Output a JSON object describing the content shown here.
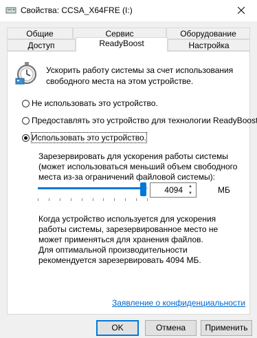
{
  "window": {
    "title": "Свойства: CCSA_X64FRE (I:)"
  },
  "tabs_row1": [
    "Общие",
    "Сервис",
    "Оборудование"
  ],
  "tabs_row2": [
    "Доступ",
    "ReadyBoost",
    "Настройка"
  ],
  "active_tab": "ReadyBoost",
  "intro_text": "Ускорить работу системы за счет использования свободного места на этом устройстве.",
  "options": [
    {
      "label": "Не использовать это устройство.",
      "checked": false
    },
    {
      "label": "Предоставлять это устройство для технологии ReadyBoost.",
      "checked": false
    },
    {
      "label": "Использовать это устройство.",
      "checked": true
    }
  ],
  "reserve_label": "Зарезервировать для ускорения работы системы (может использоваться меньший объем свободного места из-за ограничений файловой системы):",
  "reserve": {
    "value": "4094",
    "unit": "МБ",
    "slider_fraction": 0.99
  },
  "note_1": "Когда устройство используется для ускорения работы системы, зарезервированное место не может применяться для хранения файлов.",
  "note_2": "Для оптимальной производительности рекомендуется зарезервировать 4094 МБ.",
  "privacy_link": "Заявление о конфиденциальности",
  "buttons": {
    "ok": "OK",
    "cancel": "Отмена",
    "apply": "Применить"
  },
  "icons": {
    "title": "drive-properties-icon",
    "readyboost": "readyboost-stopwatch-icon",
    "close": "close-icon"
  },
  "colors": {
    "accent": "#0078d7",
    "link": "#0066cc"
  }
}
